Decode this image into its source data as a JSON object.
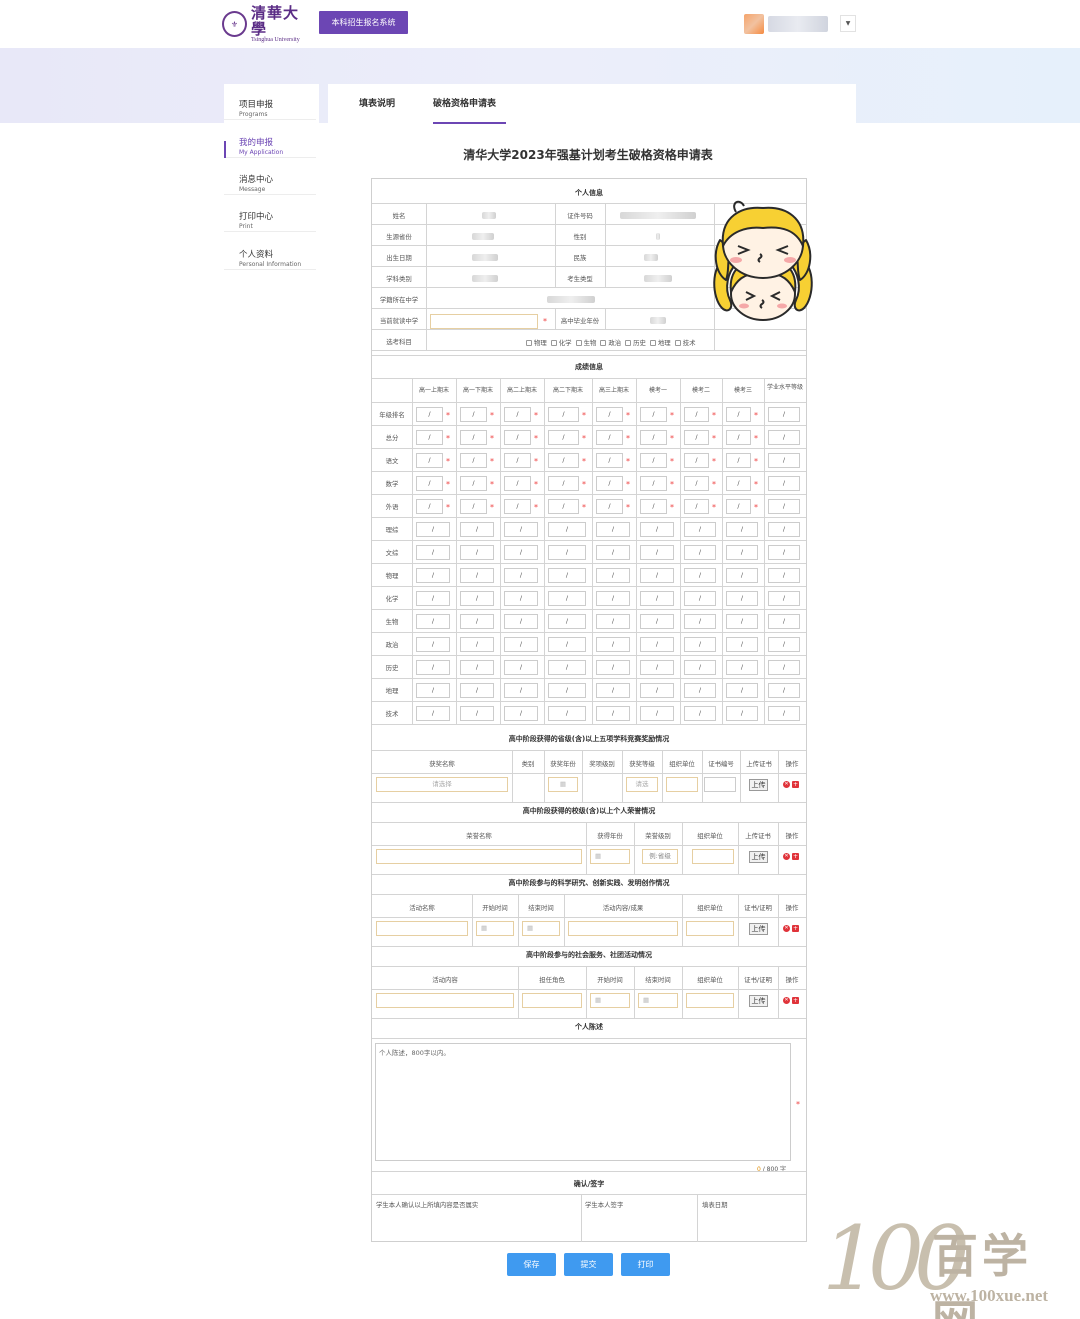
{
  "header": {
    "logo_cn": "清華大學",
    "logo_en": "Tsinghua University",
    "system_button": "本科招生报名系统"
  },
  "sidebar": {
    "items": [
      {
        "label": "项目申报",
        "sub": "Programs"
      },
      {
        "label": "我的申报",
        "sub": "My Application"
      },
      {
        "label": "消息中心",
        "sub": "Message"
      },
      {
        "label": "打印中心",
        "sub": "Print"
      },
      {
        "label": "个人资料",
        "sub": "Personal Information"
      }
    ]
  },
  "tabs": [
    "填表说明",
    "破格资格申请表"
  ],
  "form": {
    "title": "清华大学2023年强基计划考生破格资格申请表",
    "personal": {
      "heading": "个人信息",
      "labels": [
        "姓名",
        "证件号码",
        "生源省份",
        "性别",
        "出生日期",
        "民族",
        "学科类别",
        "考生类型",
        "学籍所在中学",
        "当前就读中学",
        "高中毕业年份",
        "选考科目"
      ],
      "subjects": [
        "物理",
        "化学",
        "生物",
        "政治",
        "历史",
        "地理",
        "技术"
      ]
    },
    "scores": {
      "heading": "成绩信息",
      "columns": [
        "高一上期末",
        "高一下期末",
        "高二上期末",
        "高二下期末",
        "高三上期末",
        "模考一",
        "模考二",
        "模考三",
        "学业水平等级"
      ],
      "rows": [
        "年级排名",
        "总分",
        "语文",
        "数学",
        "外语",
        "理综",
        "文综",
        "物理",
        "化学",
        "生物",
        "政治",
        "历史",
        "地理",
        "技术"
      ],
      "cell": "/",
      "required_mark": "*"
    },
    "awards": {
      "heading": "高中阶段获得的省级(含)以上五项学科竞赛奖励情况",
      "columns": [
        "获奖名称",
        "类别",
        "获奖年份",
        "奖项级别",
        "获奖等级",
        "组织单位",
        "证书编号",
        "上传证书",
        "操作"
      ],
      "select_placeholder": "请选择",
      "select2_placeholder": "请选"
    },
    "honors": {
      "heading": "高中阶段获得的校级(含)以上个人荣誉情况",
      "columns": [
        "荣誉名称",
        "获得年份",
        "荣誉级别",
        "组织单位",
        "上传证书",
        "操作"
      ],
      "level_placeholder": "例:省级"
    },
    "research": {
      "heading": "高中阶段参与的科学研究、创新实践、发明创作情况",
      "columns": [
        "活动名称",
        "开始时间",
        "结束时间",
        "活动内容/成果",
        "组织单位",
        "证书/证明",
        "操作"
      ]
    },
    "service": {
      "heading": "高中阶段参与的社会服务、社团活动情况",
      "columns": [
        "活动内容",
        "担任角色",
        "开始时间",
        "结束时间",
        "组织单位",
        "证书/证明",
        "操作"
      ]
    },
    "statement": {
      "heading": "个人陈述",
      "placeholder": "个人陈述，800字以内。",
      "count": "0",
      "limit": "/ 800 字"
    },
    "confirm": {
      "heading": "确认/签字",
      "labels": [
        "学生本人确认以上所填内容是否属实",
        "学生本人签字",
        "填表日期"
      ]
    },
    "upload_label": "上传"
  },
  "actions": [
    "保存",
    "提交",
    "打印"
  ],
  "watermark": {
    "num": "100",
    "cn": "百学网",
    "url": "www.100xue.net"
  }
}
